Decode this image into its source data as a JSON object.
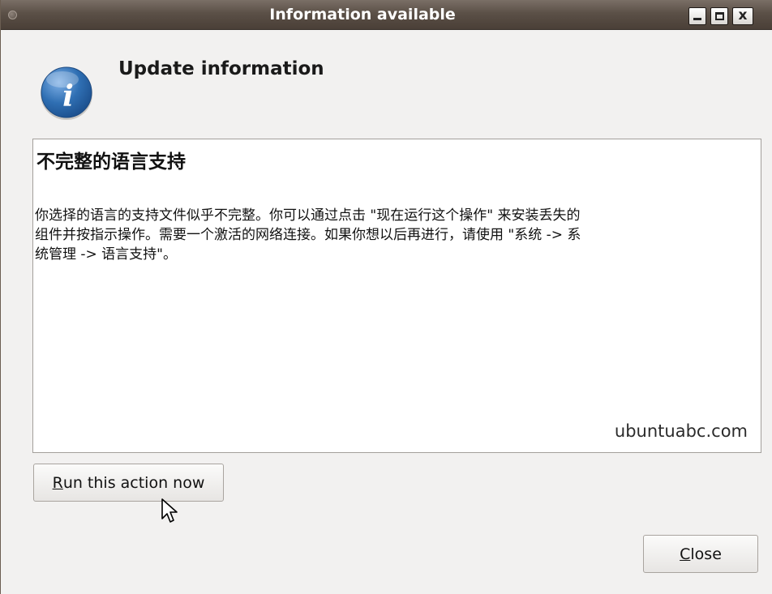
{
  "window": {
    "title": "Information available",
    "controls": {
      "minimize_icon": "minimize-icon",
      "maximize_icon": "maximize-icon",
      "close_icon": "close-icon",
      "close_glyph": "x"
    }
  },
  "header": {
    "icon": "info-icon",
    "title": "Update information"
  },
  "message": {
    "title": "不完整的语言支持",
    "line1": "你选择的语言的支持文件似乎不完整。你可以通过点击 \"现在运行这个操作\" 来安装丢失的",
    "line2": "组件并按指示操作。需要一个激活的网络连接。如果你想以后再进行，请使用 \"系统 -> 系",
    "line3": "统管理 -> 语言支持\"。",
    "watermark": "ubuntuabc.com"
  },
  "actions": {
    "run_mnemonic": "R",
    "run_rest": "un this action now",
    "close_mnemonic": "C",
    "close_rest": "lose"
  },
  "colors": {
    "titlebar": "#5b5047",
    "window_bg": "#f2f1f0",
    "info_icon_blue": "#2f6fb3"
  }
}
